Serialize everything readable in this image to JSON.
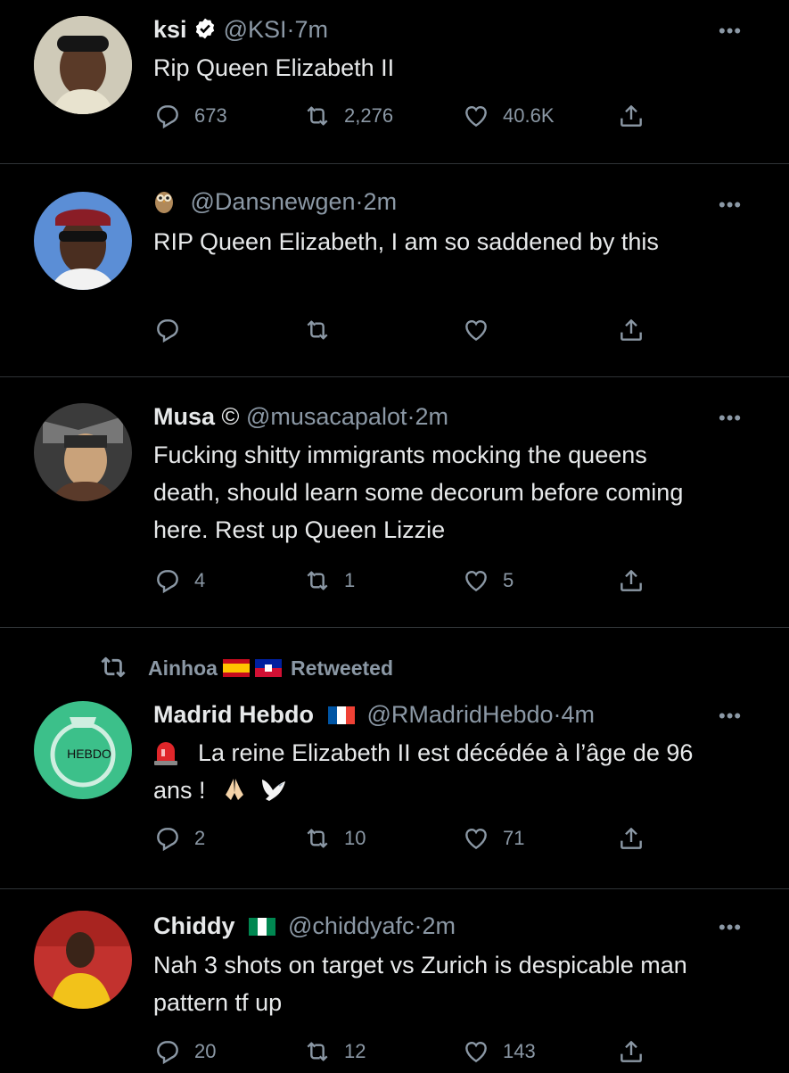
{
  "tweets": [
    {
      "name": "ksi",
      "handle": "@KSI",
      "time": "7m",
      "text": "Rip Queen Elizabeth II",
      "replies": "673",
      "retweets": "2,276",
      "likes": "40.6K"
    },
    {
      "name": "",
      "handle": "@Dansnewgen",
      "time": "2m",
      "text": "RIP Queen Elizabeth, I am so saddened by this",
      "replies": "",
      "retweets": "",
      "likes": ""
    },
    {
      "name": "Musa",
      "name_suffix": "©",
      "handle": "@musacapalot",
      "time": "2m",
      "text": "Fucking shitty immigrants mocking the queens death, should learn some decorum before coming here. Rest up Queen Lizzie",
      "replies": "4",
      "retweets": "1",
      "likes": "5"
    },
    {
      "retweeted_by": "Ainhoa",
      "retweeted_label": "Retweeted",
      "name": "Madrid Hebdo",
      "handle": "@RMadridHebdo",
      "time": "4m",
      "text": "La reine Elizabeth II est décédée à l’âge de 96 ans !",
      "replies": "2",
      "retweets": "10",
      "likes": "71",
      "avatar_text": "HEBDO"
    },
    {
      "name": "Chiddy",
      "handle": "@chiddyafc",
      "time": "2m",
      "text": "Nah 3 shots on target vs Zurich is despicable man pattern tf up",
      "replies": "20",
      "retweets": "12",
      "likes": "143"
    }
  ],
  "separator": "·",
  "more_label": "•••",
  "colors": {
    "background": "#000000",
    "text": "#e7e9ea",
    "muted": "#8b98a5",
    "verified": "#ffffff"
  }
}
